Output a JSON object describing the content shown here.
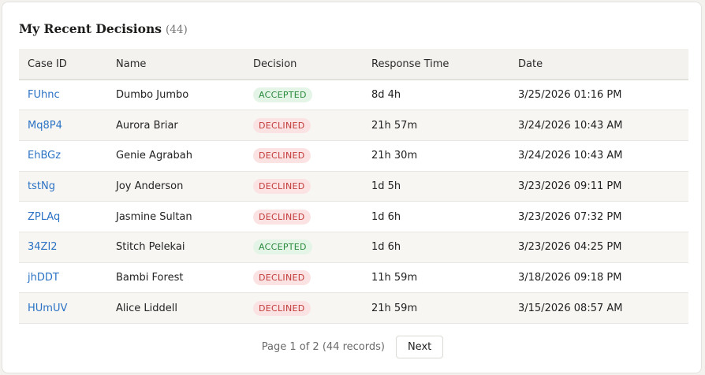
{
  "header": {
    "title": "My Recent Decisions",
    "count": "(44)"
  },
  "table": {
    "columns": [
      "Case ID",
      "Name",
      "Decision",
      "Response Time",
      "Date"
    ],
    "rows": [
      {
        "case_id": "FUhnc",
        "name": "Dumbo Jumbo",
        "decision": "ACCEPTED",
        "response_time": "8d 4h",
        "date": "3/25/2026 01:16 PM"
      },
      {
        "case_id": "Mq8P4",
        "name": "Aurora Briar",
        "decision": "DECLINED",
        "response_time": "21h 57m",
        "date": "3/24/2026 10:43 AM"
      },
      {
        "case_id": "EhBGz",
        "name": "Genie Agrabah",
        "decision": "DECLINED",
        "response_time": "21h 30m",
        "date": "3/24/2026 10:43 AM"
      },
      {
        "case_id": "tstNg",
        "name": "Joy Anderson",
        "decision": "DECLINED",
        "response_time": "1d 5h",
        "date": "3/23/2026 09:11 PM"
      },
      {
        "case_id": "ZPLAq",
        "name": "Jasmine Sultan",
        "decision": "DECLINED",
        "response_time": "1d 6h",
        "date": "3/23/2026 07:32 PM"
      },
      {
        "case_id": "34ZI2",
        "name": "Stitch Pelekai",
        "decision": "ACCEPTED",
        "response_time": "1d 6h",
        "date": "3/23/2026 04:25 PM"
      },
      {
        "case_id": "jhDDT",
        "name": "Bambi Forest",
        "decision": "DECLINED",
        "response_time": "11h 59m",
        "date": "3/18/2026 09:18 PM"
      },
      {
        "case_id": "HUmUV",
        "name": "Alice Liddell",
        "decision": "DECLINED",
        "response_time": "21h 59m",
        "date": "3/15/2026 08:57 AM"
      }
    ]
  },
  "pagination": {
    "info": "Page 1 of 2 (44 records)",
    "next_label": "Next"
  },
  "colors": {
    "link": "#2b72c4",
    "accepted": "#2a8a3e",
    "declined": "#c23a3a"
  }
}
